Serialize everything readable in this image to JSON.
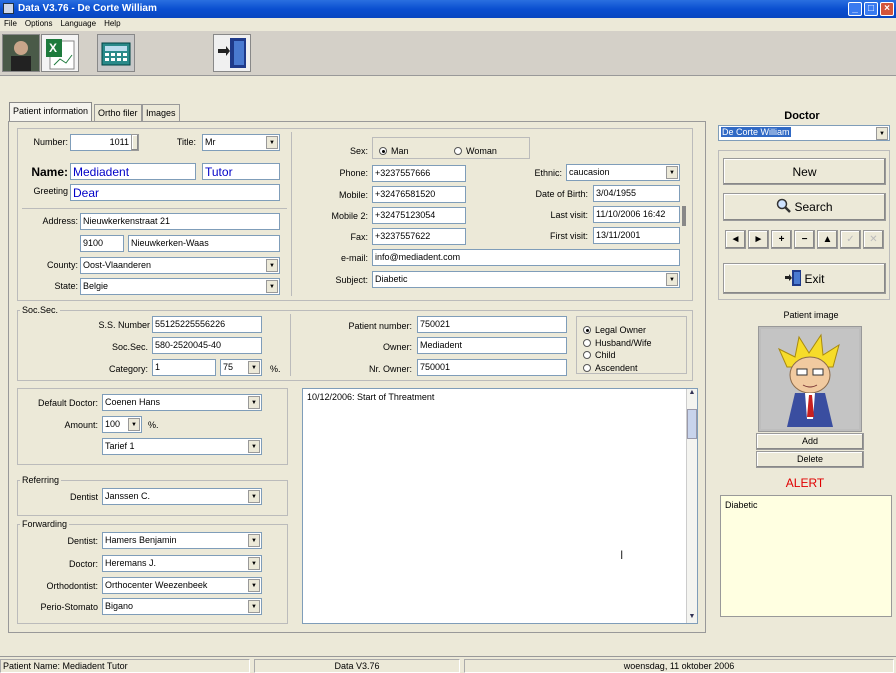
{
  "window": {
    "title": "Data V3.76 - De Corte William"
  },
  "menu": [
    "File",
    "Options",
    "Language",
    "Help"
  ],
  "tabs": [
    "Patient information",
    "Ortho filer",
    "Images"
  ],
  "patient": {
    "number_label": "Number:",
    "number": "1011",
    "title_label": "Title:",
    "title": "Mr",
    "name_label": "Name:",
    "name": "Mediadent",
    "firstname": "Tutor",
    "greeting_label": "Greeting",
    "greeting": "Dear",
    "address_label": "Address:",
    "street": "Nieuwkerkenstraat 21",
    "zip": "9100",
    "city": "Nieuwkerken-Waas",
    "county_label": "County:",
    "county": "Oost-Vlaanderen",
    "state_label": "State:",
    "state": "Belgie",
    "sex_label": "Sex:",
    "sex_man": "Man",
    "sex_woman": "Woman",
    "phone_label": "Phone:",
    "phone": "+3237557666",
    "mobile_label": "Mobile:",
    "mobile": "+32476581520",
    "mobile2_label": "Mobile 2:",
    "mobile2": "+32475123054",
    "fax_label": "Fax:",
    "fax": "+3237557622",
    "email_label": "e-mail:",
    "email": "info@mediadent.com",
    "subject_label": "Subject:",
    "subject": "Diabetic",
    "ethnic_label": "Ethnic:",
    "ethnic": "caucasion",
    "dob_label": "Date of Birth:",
    "dob": "3/04/1955",
    "last_visit_label": "Last visit:",
    "last_visit": "11/10/2006 16:42",
    "first_visit_label": "First visit:",
    "first_visit": "13/11/2001"
  },
  "socsec": {
    "group_title": "Soc.Sec.",
    "ss_number_label": "S.S. Number",
    "ss_number": "55125225556226",
    "socsec_label": "Soc.Sec.",
    "socsec": "580-2520045-40",
    "category_label": "Category:",
    "category": "1",
    "percent": "75",
    "percent_sign": "%.",
    "patient_number_label": "Patient number:",
    "patient_number": "750021",
    "owner_label": "Owner:",
    "owner": "Mediadent",
    "nr_owner_label": "Nr. Owner:",
    "nr_owner": "750001",
    "relations": [
      "Legal Owner",
      "Husband/Wife",
      "Child",
      "Ascendent"
    ]
  },
  "billing": {
    "default_doctor_label": "Default Doctor:",
    "default_doctor": "Coenen Hans",
    "amount_label": "Amount:",
    "amount": "100",
    "amount_pct": "%.",
    "tariff": "Tarief 1"
  },
  "referring": {
    "group_title": "Referring",
    "dentist_label": "Dentist",
    "dentist": "Janssen C."
  },
  "forwarding": {
    "group_title": "Forwarding",
    "dentist_label": "Dentist:",
    "dentist": "Hamers Benjamin",
    "doctor_label": "Doctor:",
    "doctor": "Heremans J.",
    "orthodontist_label": "Orthodontist:",
    "orthodontist": "Orthocenter Weezenbeek",
    "perio_label": "Perio-Stomato",
    "perio": "Bigano"
  },
  "notes": "10/12/2006: Start of Threatment",
  "sidebar": {
    "doctor_title": "Doctor",
    "doctor": "De Corte William",
    "new_label": "New",
    "search_label": "Search",
    "exit_label": "Exit",
    "nav": [
      "◄",
      "►",
      "+",
      "−",
      "▲",
      "✓",
      "✕"
    ],
    "patient_image_label": "Patient image",
    "add_label": "Add",
    "delete_label": "Delete",
    "alert_title": "ALERT",
    "alert_text": "Diabetic"
  },
  "status": {
    "patient": "Patient Name: Mediadent Tutor",
    "version": "Data V3.76",
    "date": "woensdag, 11 oktober 2006"
  },
  "colors": {
    "title_bar": "#0a4fd0",
    "alert": "#e00000",
    "name_text": "#0000c8"
  }
}
